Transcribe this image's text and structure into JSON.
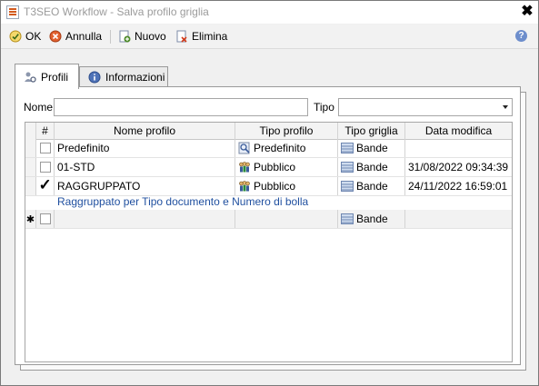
{
  "window": {
    "title": "T3SEO Workflow - Salva profilo griglia",
    "close_glyph": "✖"
  },
  "toolbar": {
    "ok_label": "OK",
    "cancel_label": "Annulla",
    "new_label": "Nuovo",
    "delete_label": "Elimina",
    "help_glyph": "?"
  },
  "tabs": [
    {
      "label": "Profili",
      "icon": "users-gear-icon",
      "active": true
    },
    {
      "label": "Informazioni",
      "icon": "info-icon",
      "active": false
    }
  ],
  "filters": {
    "name_label": "Nome",
    "name_value": "",
    "type_label": "Tipo",
    "type_value": ""
  },
  "grid": {
    "columns": [
      "#",
      "Nome profilo",
      "Tipo profilo",
      "Tipo griglia",
      "Data modifica"
    ],
    "rows": [
      {
        "checked": false,
        "name": "Predefinito",
        "profile_type": "Predefinito",
        "profile_icon": "search-doc-icon",
        "grid_type": "Bande",
        "modified": ""
      },
      {
        "checked": false,
        "name": "01-STD",
        "profile_type": "Pubblico",
        "profile_icon": "people-icon",
        "grid_type": "Bande",
        "modified": "31/08/2022 09:34:39"
      },
      {
        "checked": true,
        "name": "RAGGRUPPATO",
        "profile_type": "Pubblico",
        "profile_icon": "people-icon",
        "grid_type": "Bande",
        "modified": "24/11/2022 16:59:01"
      }
    ],
    "group_description": "Raggruppato per Tipo documento e Numero di bolla",
    "new_row": {
      "marker": "✱",
      "grid_type": "Bande"
    }
  },
  "colors": {
    "accent": "#1f4f9f",
    "title_text": "#9b9b9b",
    "border": "#9a9a9a"
  }
}
